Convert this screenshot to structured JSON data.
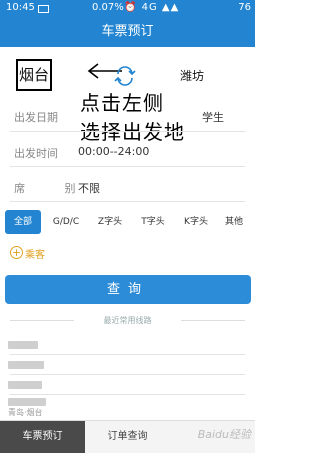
{
  "status_bar": {
    "time": "10:45",
    "battery_percent": "0.07%",
    "signal_icons": "⏰ 4G ▲▲",
    "battery": "76"
  },
  "header": {
    "title": "车票预订"
  },
  "stations": {
    "from": "烟台",
    "to": "潍坊"
  },
  "annotation": {
    "line1": "点击左侧",
    "line2": "选择出发地"
  },
  "form": {
    "date_label": "出发日期",
    "date_value": "",
    "passenger_type": "学生",
    "time_label": "出发时间",
    "time_value": "00:00--24:00",
    "seat_label": "席 别",
    "seat_value": "不限"
  },
  "train_types": [
    "全部",
    "G/D/C",
    "Z字头",
    "T字头",
    "K字头",
    "其他"
  ],
  "add_passenger": {
    "label": "乘客"
  },
  "query_button": {
    "label": "查询"
  },
  "recent": {
    "title": "最近常用线路",
    "items": [
      "",
      "",
      "",
      "",
      "青岛·烟台"
    ]
  },
  "bottom_nav": [
    "车票预订",
    "订单查询",
    "Baidu经验"
  ],
  "colors": {
    "primary": "#2385d1",
    "accent": "#e0a020"
  },
  "icons": {
    "swap": "swap-icon",
    "add": "plus-circle-icon",
    "mail": "mail-icon"
  }
}
